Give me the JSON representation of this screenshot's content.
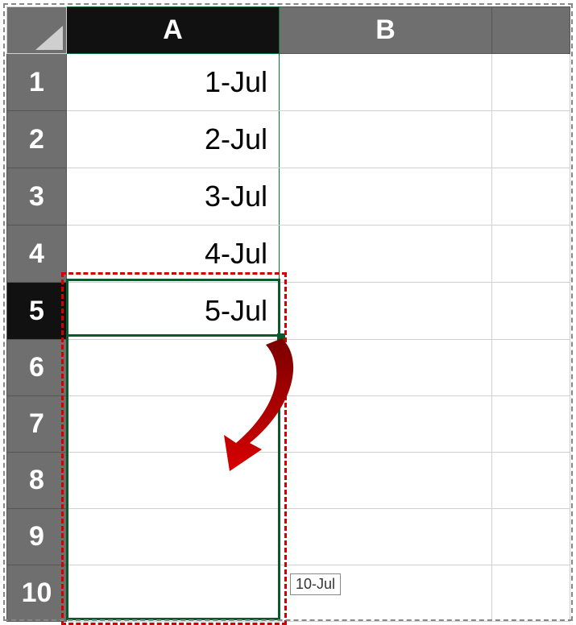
{
  "columns": {
    "A": "A",
    "B": "B"
  },
  "rows": {
    "1": "1",
    "2": "2",
    "3": "3",
    "4": "4",
    "5": "5",
    "6": "6",
    "7": "7",
    "8": "8",
    "9": "9",
    "10": "10"
  },
  "cells": {
    "A1": "1-Jul",
    "A2": "2-Jul",
    "A3": "3-Jul",
    "A4": "4-Jul",
    "A5": "5-Jul"
  },
  "tooltip": "10-Jul",
  "annotation": {
    "arrow_color": "#b00000",
    "dash_color": "#d40000",
    "selection_color": "#0a5a2b"
  },
  "selection": {
    "active_cell": "A5",
    "fill_target": "A10"
  }
}
